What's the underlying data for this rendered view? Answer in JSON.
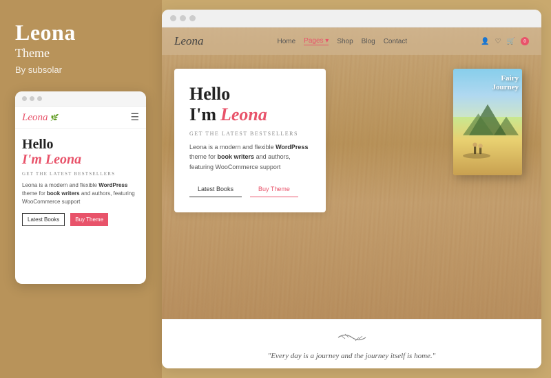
{
  "left": {
    "title": "Leona",
    "subtitle": "Theme",
    "by": "By subsolar",
    "mobile": {
      "logo": "Leona",
      "leaf_icon": "🌿",
      "hero_hello": "Hello",
      "hero_im": "I'm Leona",
      "hero_tag": "GET THE LATEST BESTSELLERS",
      "hero_body_1": "Leona is a modern and flexible",
      "hero_bold_1": "WordPress",
      "hero_body_2": "theme for",
      "hero_bold_2": "book writers",
      "hero_body_3": "and authors, featuring WooCommerce support",
      "btn1": "Latest Books",
      "btn2": "Buy Theme"
    }
  },
  "right": {
    "browser_dots": [
      "dot1",
      "dot2",
      "dot3"
    ],
    "nav": {
      "logo": "Leona",
      "links": [
        "Home",
        "Pages ▾",
        "Shop",
        "Blog",
        "Contact"
      ],
      "active": "Pages ▾",
      "cart_count": "0"
    },
    "hero": {
      "hello": "Hello",
      "im": "I'm",
      "name": "Leona",
      "tagline": "GET THE LATEST BESTSELLERS",
      "desc_1": "Leona is a modern and flexible ",
      "desc_bold_1": "WordPress",
      "desc_2": " theme for ",
      "desc_bold_2": "book writers",
      "desc_3": " and authors, featuring WooCommerce support",
      "btn1": "Latest Books",
      "btn2": "Buy Theme"
    },
    "book": {
      "title_line1": "Fairy",
      "title_line2": "Journey"
    },
    "quote": {
      "decoration": "❧",
      "text": "\"Every day is a journey and the journey itself is home.\""
    }
  }
}
